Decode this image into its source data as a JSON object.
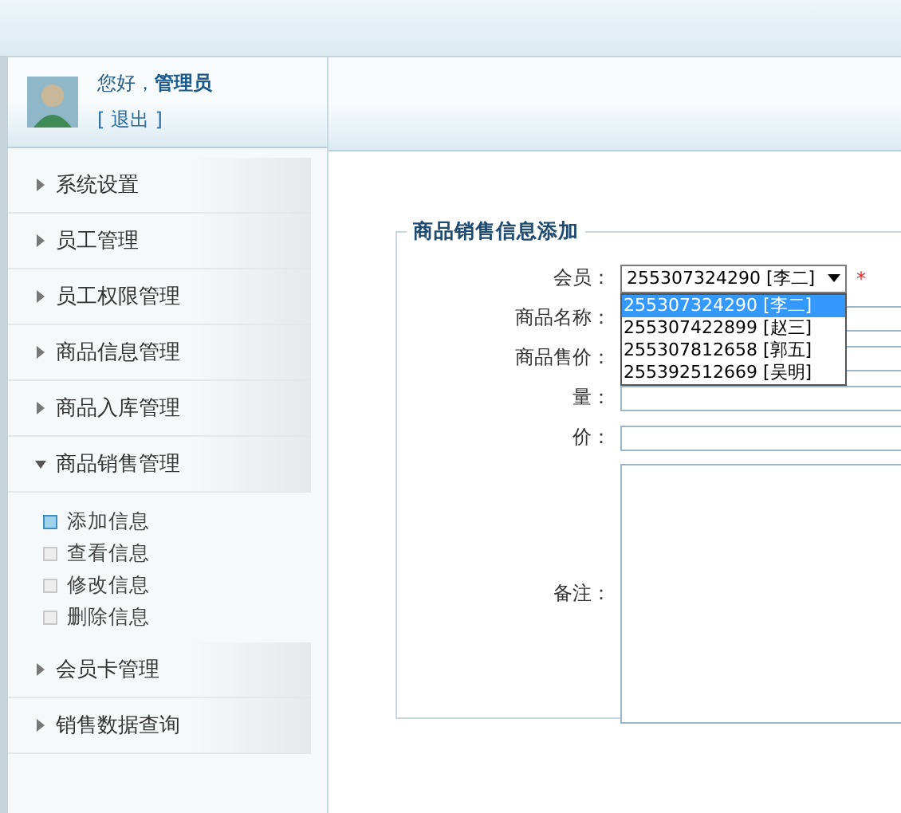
{
  "user": {
    "greeting": "您好，",
    "name": "管理员",
    "logout": "[ 退出 ]"
  },
  "menu": [
    {
      "label": "系统设置",
      "expanded": false
    },
    {
      "label": "员工管理",
      "expanded": false
    },
    {
      "label": "员工权限管理",
      "expanded": false
    },
    {
      "label": "商品信息管理",
      "expanded": false
    },
    {
      "label": "商品入库管理",
      "expanded": false
    },
    {
      "label": "商品销售管理",
      "expanded": true,
      "children": [
        {
          "label": "添加信息",
          "selected": true
        },
        {
          "label": "查看信息",
          "selected": false
        },
        {
          "label": "修改信息",
          "selected": false
        },
        {
          "label": "删除信息",
          "selected": false
        }
      ]
    },
    {
      "label": "会员卡管理",
      "expanded": false
    },
    {
      "label": "销售数据查询",
      "expanded": false
    }
  ],
  "form": {
    "legend": "商品销售信息添加",
    "fields": [
      {
        "kind": "select",
        "label": "会员：",
        "value": "255307324290 [李二]",
        "required_mark": "*",
        "open": true,
        "options": [
          {
            "label": "255307324290 [李二]",
            "selected": true
          },
          {
            "label": "255307422899 [赵三]",
            "selected": false
          },
          {
            "label": "255307812658 [郭五]",
            "selected": false
          },
          {
            "label": "255392512669 [吴明]",
            "selected": false
          }
        ]
      },
      {
        "kind": "text",
        "label": "商品名称："
      },
      {
        "kind": "text",
        "label": "商品售价："
      },
      {
        "kind": "text",
        "label": "量："
      },
      {
        "kind": "text",
        "label": "价："
      },
      {
        "kind": "textarea",
        "label": "备注："
      }
    ]
  }
}
